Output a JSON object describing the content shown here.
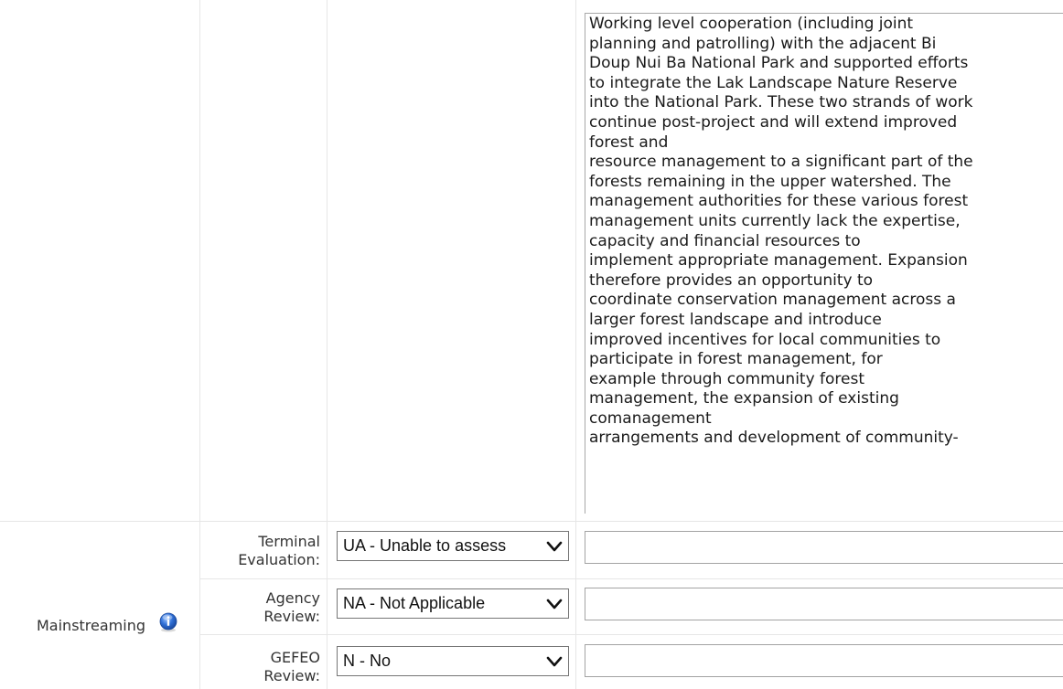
{
  "description_text": "Working level cooperation (including joint\nplanning and patrolling) with the adjacent Bi\nDoup Nui Ba National Park and supported efforts\nto integrate the Lak Landscape Nature Reserve\ninto the National Park. These two strands of work\ncontinue post-project and will extend improved\nforest and\nresource management to a significant part of the\nforests remaining in the upper watershed. The\nmanagement authorities for these various forest\nmanagement units currently lack the expertise,\ncapacity and financial resources to\nimplement appropriate management. Expansion\ntherefore provides an opportunity to\ncoordinate conservation management across a\nlarger forest landscape and introduce\nimproved incentives for local communities to\nparticipate in forest management, for\nexample through community forest\nmanagement, the expansion of existing\ncomanagement\narrangements and development of community-",
  "section": {
    "label": "Mainstreaming",
    "icon": "info-icon"
  },
  "rows": [
    {
      "label_line1": "Terminal",
      "label_line2": "Evaluation:",
      "selected": "UA - Unable to assess",
      "comment": ""
    },
    {
      "label_line1": "Agency",
      "label_line2": "Review:",
      "selected": "NA - Not Applicable",
      "comment": ""
    },
    {
      "label_line1": "GEFEO",
      "label_line2": "Review:",
      "selected": "N - No",
      "comment": ""
    }
  ],
  "colors": {
    "grid": "#e6e6e6",
    "icon_blue": "#2f6fd6"
  }
}
